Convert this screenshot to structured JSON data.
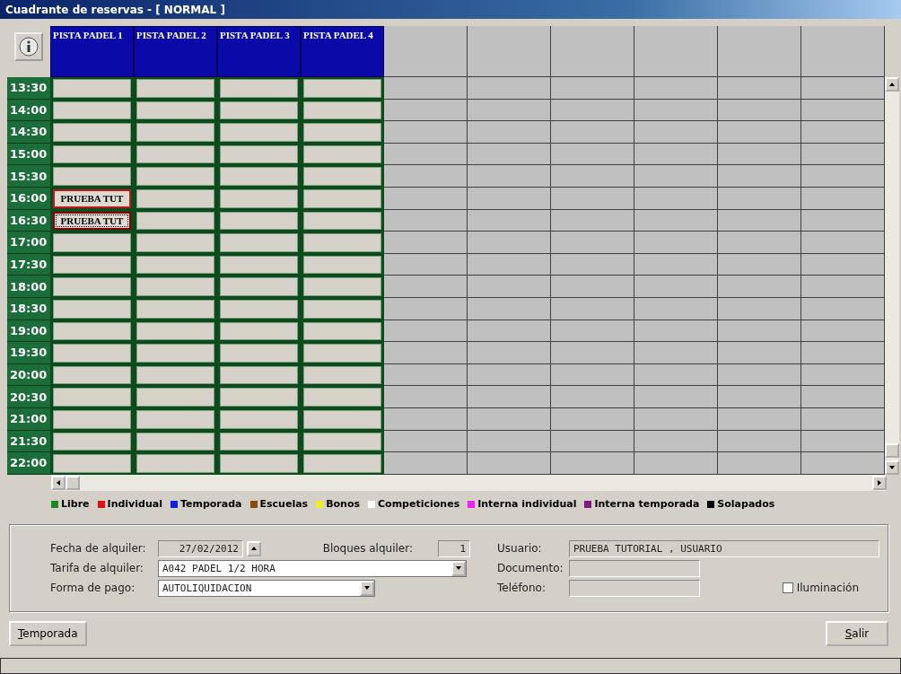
{
  "window": {
    "title": "Cuadrante de reservas - [ NORMAL ]"
  },
  "courts": [
    "PISTA PADEL 1",
    "PISTA PADEL 2",
    "PISTA PADEL 3",
    "PISTA PADEL 4"
  ],
  "rows": [
    {
      "time": "13:30",
      "cells": [
        {
          "booked": false
        },
        {
          "booked": false
        },
        {
          "booked": false
        },
        {
          "booked": false
        }
      ]
    },
    {
      "time": "14:00",
      "cells": [
        {
          "booked": false
        },
        {
          "booked": false
        },
        {
          "booked": false
        },
        {
          "booked": false
        }
      ]
    },
    {
      "time": "14:30",
      "cells": [
        {
          "booked": false
        },
        {
          "booked": false
        },
        {
          "booked": false
        },
        {
          "booked": false
        }
      ]
    },
    {
      "time": "15:00",
      "cells": [
        {
          "booked": false
        },
        {
          "booked": false
        },
        {
          "booked": false
        },
        {
          "booked": false
        }
      ]
    },
    {
      "time": "15:30",
      "cells": [
        {
          "booked": false
        },
        {
          "booked": false
        },
        {
          "booked": false
        },
        {
          "booked": false
        }
      ]
    },
    {
      "time": "16:00",
      "cells": [
        {
          "booked": true,
          "text": "PRUEBA TUT",
          "selected": false
        },
        {
          "booked": false
        },
        {
          "booked": false
        },
        {
          "booked": false
        }
      ]
    },
    {
      "time": "16:30",
      "cells": [
        {
          "booked": true,
          "text": "PRUEBA TUT",
          "selected": true
        },
        {
          "booked": false
        },
        {
          "booked": false
        },
        {
          "booked": false
        }
      ]
    },
    {
      "time": "17:00",
      "cells": [
        {
          "booked": false
        },
        {
          "booked": false
        },
        {
          "booked": false
        },
        {
          "booked": false
        }
      ]
    },
    {
      "time": "17:30",
      "cells": [
        {
          "booked": false
        },
        {
          "booked": false
        },
        {
          "booked": false
        },
        {
          "booked": false
        }
      ]
    },
    {
      "time": "18:00",
      "cells": [
        {
          "booked": false
        },
        {
          "booked": false
        },
        {
          "booked": false
        },
        {
          "booked": false
        }
      ]
    },
    {
      "time": "18:30",
      "cells": [
        {
          "booked": false
        },
        {
          "booked": false
        },
        {
          "booked": false
        },
        {
          "booked": false
        }
      ]
    },
    {
      "time": "19:00",
      "cells": [
        {
          "booked": false
        },
        {
          "booked": false
        },
        {
          "booked": false
        },
        {
          "booked": false
        }
      ]
    },
    {
      "time": "19:30",
      "cells": [
        {
          "booked": false
        },
        {
          "booked": false
        },
        {
          "booked": false
        },
        {
          "booked": false
        }
      ]
    },
    {
      "time": "20:00",
      "cells": [
        {
          "booked": false
        },
        {
          "booked": false
        },
        {
          "booked": false
        },
        {
          "booked": false
        }
      ]
    },
    {
      "time": "20:30",
      "cells": [
        {
          "booked": false
        },
        {
          "booked": false
        },
        {
          "booked": false
        },
        {
          "booked": false
        }
      ]
    },
    {
      "time": "21:00",
      "cells": [
        {
          "booked": false
        },
        {
          "booked": false
        },
        {
          "booked": false
        },
        {
          "booked": false
        }
      ]
    },
    {
      "time": "21:30",
      "cells": [
        {
          "booked": false
        },
        {
          "booked": false
        },
        {
          "booked": false
        },
        {
          "booked": false
        }
      ]
    },
    {
      "time": "22:00",
      "cells": [
        {
          "booked": false
        },
        {
          "booked": false
        },
        {
          "booked": false
        },
        {
          "booked": false
        }
      ]
    }
  ],
  "legend": [
    {
      "label": "Libre",
      "color": "#1a8a1a"
    },
    {
      "label": "Individual",
      "color": "#e01010"
    },
    {
      "label": "Temporada",
      "color": "#1020e0"
    },
    {
      "label": "Escuelas",
      "color": "#8a4a10"
    },
    {
      "label": "Bonos",
      "color": "#f0f020"
    },
    {
      "label": "Competiciones",
      "color": "#ffffff"
    },
    {
      "label": "Interna individual",
      "color": "#f020f0"
    },
    {
      "label": "Interna temporada",
      "color": "#801880"
    },
    {
      "label": "Solapados",
      "color": "#000000"
    }
  ],
  "form": {
    "fecha": {
      "label": "Fecha de alquiler:",
      "value": "27/02/2012"
    },
    "bloques": {
      "label": "Bloques alquiler:",
      "value": "1"
    },
    "usuario": {
      "label": "Usuario:",
      "value": "PRUEBA TUTORIAL , USUARIO"
    },
    "tarifa": {
      "label": "Tarifa de alquiler:",
      "value": "A042 PADEL 1/2 HORA"
    },
    "documento": {
      "label": "Documento:"
    },
    "pago": {
      "label": "Forma de pago:",
      "value": "AUTOLIQUIDACION"
    },
    "telefono": {
      "label": "Teléfono:"
    },
    "iluminacion": {
      "label": "Iluminación",
      "checked": false
    }
  },
  "buttons": [
    {
      "label": "Temporada"
    },
    {
      "label": "Salir"
    }
  ]
}
